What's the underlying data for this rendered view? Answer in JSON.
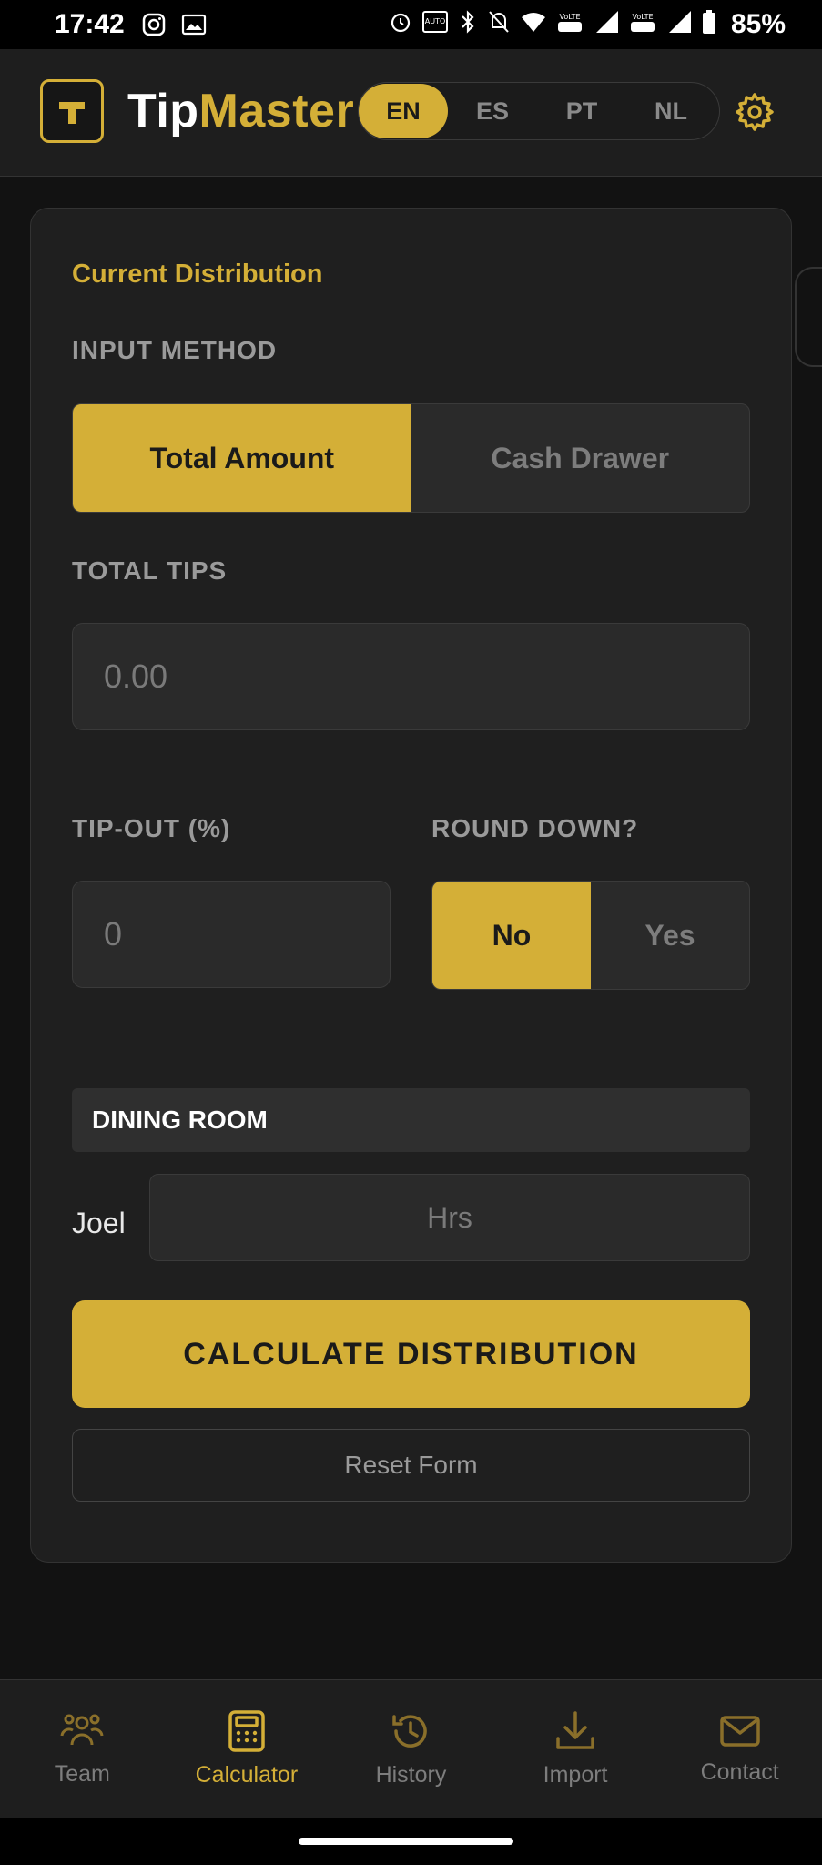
{
  "status_bar": {
    "time": "17:42",
    "battery": "85%",
    "left_icons": [
      "instagram-icon",
      "gallery-icon"
    ],
    "right_icons": [
      "alarm-icon",
      "auto-hz-icon",
      "bluetooth-icon",
      "mute-icon",
      "wifi-icon",
      "volte-lte-icon",
      "signal-icon",
      "signal-icon",
      "battery-icon"
    ]
  },
  "header": {
    "logo_letter": "T",
    "title_part1": "Tip",
    "title_part2": "Master",
    "languages": [
      "EN",
      "ES",
      "PT",
      "NL"
    ],
    "active_language": "EN"
  },
  "calculator": {
    "section_title": "Current Distribution",
    "input_method_label": "INPUT METHOD",
    "input_methods": [
      "Total Amount",
      "Cash Drawer"
    ],
    "active_input_method": "Total Amount",
    "total_tips_label": "TOTAL TIPS",
    "total_tips_placeholder": "0.00",
    "tip_out_label": "TIP-OUT (%)",
    "tip_out_placeholder": "0",
    "round_down_label": "ROUND DOWN?",
    "round_down_options": [
      "No",
      "Yes"
    ],
    "round_down_selected": "No",
    "group_name": "DINING ROOM",
    "member_name": "Joel",
    "hours_placeholder": "Hrs",
    "calculate_label": "CALCULATE DISTRIBUTION",
    "reset_label": "Reset Form"
  },
  "nav": {
    "items": [
      {
        "label": "Team",
        "icon": "team-icon"
      },
      {
        "label": "Calculator",
        "icon": "calculator-icon"
      },
      {
        "label": "History",
        "icon": "history-icon"
      },
      {
        "label": "Import",
        "icon": "download-icon"
      },
      {
        "label": "Contact",
        "icon": "mail-icon"
      }
    ],
    "active": "Calculator"
  },
  "colors": {
    "accent": "#d4af37",
    "background": "#121212",
    "card": "#1f1f1f"
  }
}
